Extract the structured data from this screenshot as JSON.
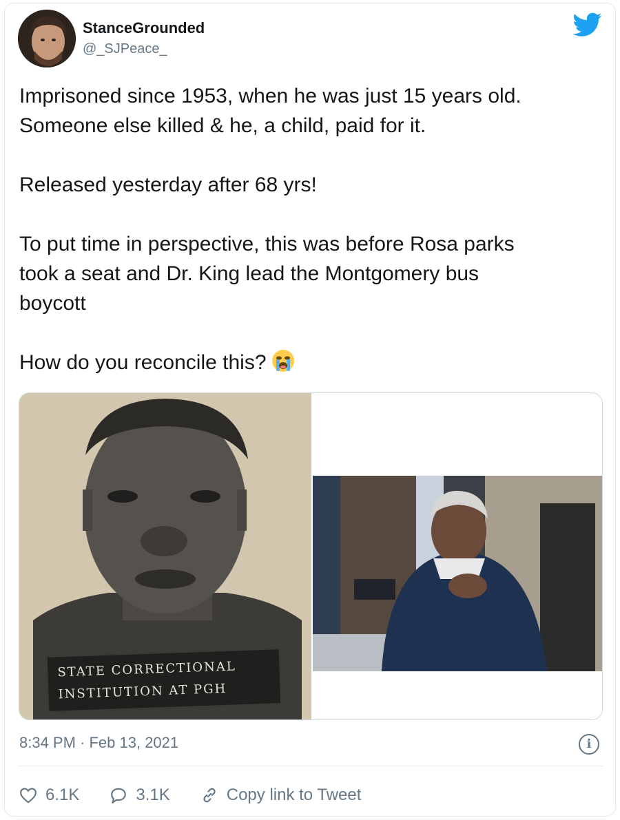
{
  "tweet": {
    "author": {
      "name": "StanceGrounded",
      "handle": "@_SJPeace_"
    },
    "paragraphs": [
      "Imprisoned since 1953, when he was just 15 years old.",
      "Someone else killed & he, a child, paid for it.",
      "Released yesterday after 68 yrs!",
      "To put time in perspective, this was before Rosa parks",
      "took a seat and Dr. King lead the Montgomery bus",
      "boycott",
      "How do you reconcile this?"
    ],
    "media": {
      "left_plate_line1": "STATE CORRECTIONAL",
      "left_plate_line2": "INSTITUTION AT   PGH"
    },
    "timestamp": "8:34 PM · Feb 13, 2021",
    "info_glyph": "i",
    "actions": {
      "likes": "6.1K",
      "replies": "3.1K",
      "copy_link": "Copy link to Tweet"
    }
  },
  "colors": {
    "twitter_blue": "#1da1f2",
    "muted": "#657786",
    "text": "#14171a",
    "border": "#e1e8ed"
  },
  "icons": [
    "twitter-bird-icon",
    "loudly-crying-face-emoji",
    "info-icon",
    "heart-icon",
    "reply-bubble-icon",
    "link-icon"
  ]
}
